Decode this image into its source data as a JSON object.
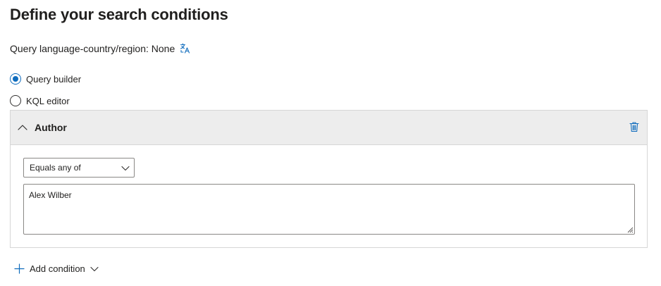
{
  "page": {
    "title": "Define your search conditions"
  },
  "query_language": {
    "label": "Query language-country/region: None",
    "icon": "translate-icon"
  },
  "mode": {
    "options": [
      {
        "label": "Query builder",
        "checked": true
      },
      {
        "label": "KQL editor",
        "checked": false
      }
    ]
  },
  "condition": {
    "name": "Author",
    "operator": "Equals any of",
    "value": "Alex Wilber",
    "expanded": true
  },
  "actions": {
    "add_condition": "Add condition"
  },
  "colors": {
    "accent": "#0f6cbd",
    "header_bg": "#ededed",
    "border": "#d6d6d6"
  },
  "icons": [
    "translate-icon",
    "chevron-up-icon",
    "trash-icon",
    "chevron-down-icon",
    "resize-grip-icon",
    "plus-icon"
  ]
}
